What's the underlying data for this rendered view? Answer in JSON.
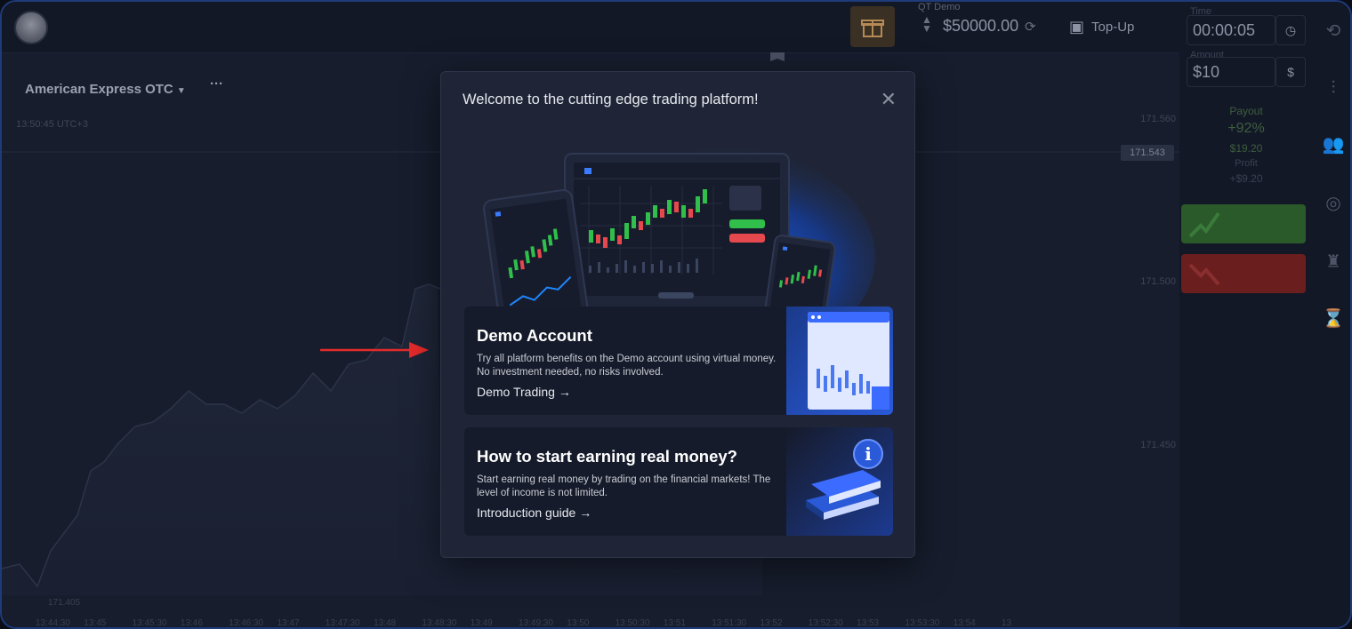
{
  "topbar": {
    "account_label": "QT Demo",
    "balance": "$50000.00",
    "topup_label": "Top-Up"
  },
  "chart": {
    "asset_name": "American Express OTC",
    "clock": "13:50:45 UTC+3",
    "price_current": "171.543",
    "price_levels": [
      "171.560",
      "171.500",
      "171.450"
    ],
    "price_low": "171.405",
    "time_ticks": [
      "13:44:30",
      "13:45",
      "13:45:30",
      "13:46",
      "13:46:30",
      "13:47",
      "13:47:30",
      "13:48",
      "13:48:30",
      "13:49",
      "13:49:30",
      "13:50",
      "13:50:30",
      "13:51",
      "13:51:30",
      "13:52",
      "13:52:30",
      "13:53",
      "13:53:30",
      "13:54",
      "13"
    ]
  },
  "trade_panel": {
    "time_label": "Time",
    "time_value": "00:00:05",
    "amount_label": "Amount",
    "amount_value": "$10",
    "amount_currency": "$",
    "payout_label": "Payout",
    "payout_percent": "+92%",
    "payout_amount": "$19.20",
    "profit_label": "Profit",
    "profit_amount": "+$9.20"
  },
  "modal": {
    "title": "Welcome to the cutting edge trading platform!",
    "demo": {
      "title": "Demo Account",
      "desc_1": "Try all platform benefits on the Demo account using virtual money.",
      "desc_2": "No investment needed, no risks involved.",
      "link": "Demo Trading"
    },
    "earn": {
      "title": "How to start earning real money?",
      "desc_1": "Start earning real money by trading on the financial markets! The",
      "desc_2": "level of income is not limited.",
      "link": "Introduction guide"
    }
  },
  "colors": {
    "modal_bg": "#1f2536",
    "accent_blue": "#1e5ef0",
    "arrow_red": "#e52a2a"
  }
}
